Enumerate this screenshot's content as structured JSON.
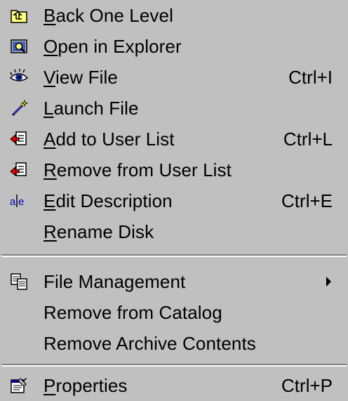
{
  "menu": {
    "items": [
      {
        "label": "Back One Level",
        "underline_index": 0,
        "shortcut": "",
        "icon": "folder-up-icon"
      },
      {
        "label": "Open in Explorer",
        "underline_index": 0,
        "shortcut": "",
        "icon": "explorer-icon"
      },
      {
        "label": "View File",
        "underline_index": 0,
        "shortcut": "Ctrl+I",
        "icon": "eye-icon"
      },
      {
        "label": "Launch File",
        "underline_index": 0,
        "shortcut": "",
        "icon": "launch-wand-icon"
      },
      {
        "label": "Add to User List",
        "underline_index": 0,
        "shortcut": "Ctrl+L",
        "icon": "add-user-list-icon"
      },
      {
        "label": "Remove from User List",
        "underline_index": 0,
        "shortcut": "",
        "icon": "remove-user-list-icon"
      },
      {
        "label": "Edit Description",
        "underline_index": 0,
        "shortcut": "Ctrl+E",
        "icon": "edit-description-icon"
      },
      {
        "label": "Rename Disk",
        "underline_index": 0,
        "shortcut": "",
        "icon": ""
      },
      {
        "label": "File Management",
        "underline_index": -1,
        "shortcut": "",
        "icon": "file-management-icon",
        "submenu": true
      },
      {
        "label": "Remove from Catalog",
        "underline_index": -1,
        "shortcut": "",
        "icon": ""
      },
      {
        "label": "Remove Archive Contents",
        "underline_index": -1,
        "shortcut": "",
        "icon": ""
      },
      {
        "label": "Properties",
        "underline_index": 0,
        "shortcut": "Ctrl+P",
        "icon": "properties-icon"
      }
    ]
  }
}
